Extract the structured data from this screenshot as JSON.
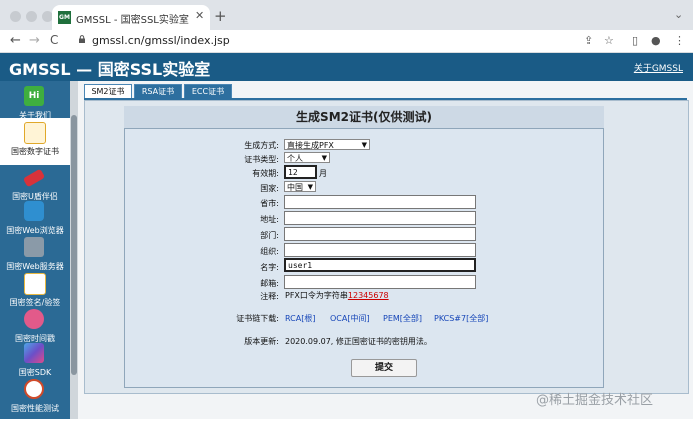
{
  "browser": {
    "tab_title": "GMSSL - 国密SSL实验室",
    "favicon_text": "GM",
    "close_glyph": "✕",
    "newtab_glyph": "+",
    "url": "gmssl.cn/gmssl/index.jsp",
    "nav": {
      "back": "←",
      "forward": "→",
      "reload": "C"
    },
    "toolbar_icons": [
      "share-icon",
      "star-icon",
      "sidebar-icon",
      "profile-icon",
      "menu-icon"
    ]
  },
  "site": {
    "title": "GMSSL — 国密SSL实验室",
    "about_link": "关于GMSSL"
  },
  "sidebar": {
    "items": [
      {
        "label": "关于我们",
        "icon": "hi-icon",
        "icon_text": "Hi",
        "color": "#3fae3f"
      },
      {
        "label": "国密数字证书",
        "icon": "certificate-icon",
        "color": "#f2c14e"
      },
      {
        "label": "国密U盾伴侣",
        "icon": "usb-key-icon",
        "color": "#d8323a"
      },
      {
        "label": "国密Web浏览器",
        "icon": "browser-icon",
        "color": "#2f8fd0"
      },
      {
        "label": "国密Web服务器",
        "icon": "server-icon",
        "color": "#8a9aa8"
      },
      {
        "label": "国密签名/验签",
        "icon": "signature-lock-icon",
        "color": "#e8b840"
      },
      {
        "label": "国密时间戳",
        "icon": "timestamp-icon",
        "color": "#e25a8a"
      },
      {
        "label": "国密SDK",
        "icon": "sdk-icon",
        "color": "#6b4fc8"
      },
      {
        "label": "国密性能测试",
        "icon": "performance-clock-icon",
        "color": "#d04a2a"
      }
    ]
  },
  "content_tabs": [
    "SM2证书",
    "RSA证书",
    "ECC证书"
  ],
  "form": {
    "title": "生成SM2证书(仅供测试)",
    "gen_method": {
      "label": "生成方式:",
      "value": "直接生成PFX"
    },
    "cert_type": {
      "label": "证书类型:",
      "value": "个人"
    },
    "validity": {
      "label": "有效期:",
      "value": "12",
      "unit": "月"
    },
    "country": {
      "label": "国家:",
      "value": "中国"
    },
    "province": {
      "label": "省市:",
      "value": ""
    },
    "address": {
      "label": "地址:",
      "value": ""
    },
    "department": {
      "label": "部门:",
      "value": ""
    },
    "organization": {
      "label": "组织:",
      "value": ""
    },
    "name": {
      "label": "名字:",
      "value": "user1"
    },
    "email": {
      "label": "邮箱:",
      "value": ""
    },
    "note": {
      "label": "注释:",
      "text": "PFX口令为字符串",
      "password": "12345678"
    },
    "chain": {
      "label": "证书链下载:",
      "links": [
        "RCA[根]",
        "OCA[中间]",
        "PEM[全部]",
        "PKCS#7[全部]"
      ]
    },
    "version": {
      "label": "版本更新:",
      "text": "2020.09.07, 修正国密证书的密钥用法。"
    },
    "submit_label": "提交"
  },
  "watermark": "@稀土掘金技术社区",
  "colors": {
    "header": "#1a5b86",
    "sidebar": "#2b6a95",
    "link_red": "#cc0000",
    "link_blue": "#1646b8"
  }
}
